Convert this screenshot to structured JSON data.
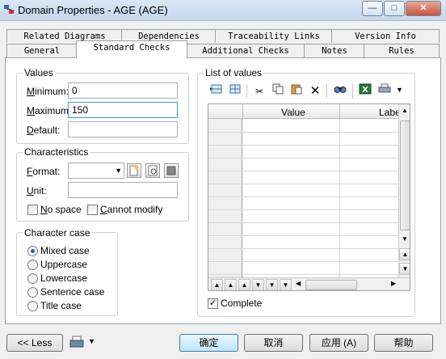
{
  "window": {
    "title": "Domain Properties - AGE (AGE)"
  },
  "tabs_row1": [
    "Related Diagrams",
    "Dependencies",
    "Traceability Links",
    "Version Info"
  ],
  "tabs_row2": [
    "General",
    "Standard Checks",
    "Additional Checks",
    "Notes",
    "Rules"
  ],
  "active_tab": "Standard Checks",
  "values_group": {
    "title": "Values",
    "minimum_label_u": "M",
    "minimum_label_rest": "inimum:",
    "minimum_value": "0",
    "maximum_label_u": "M",
    "maximum_label_rest": "aximum:",
    "maximum_value": "150",
    "default_label_u": "D",
    "default_label_rest": "efault:",
    "default_value": ""
  },
  "characteristics_group": {
    "title": "Characteristics",
    "format_label_u": "F",
    "format_label_rest": "ormat:",
    "format_value": "",
    "unit_label_u": "U",
    "unit_label_rest": "nit:",
    "unit_value": "",
    "no_space_u": "N",
    "no_space_rest": "o space",
    "no_space_checked": false,
    "cannot_modify_u": "C",
    "cannot_modify_rest": "annot modify",
    "cannot_modify_checked": false
  },
  "character_case_group": {
    "title": "Character case",
    "options": [
      "Mixed case",
      "Uppercase",
      "Lowercase",
      "Sentence case",
      "Title case"
    ],
    "selected": "Mixed case"
  },
  "list_of_values": {
    "title": "List of values",
    "columns": [
      "Value",
      "Labe"
    ],
    "rows": []
  },
  "complete_checkbox": {
    "label": "Complete",
    "checked": true
  },
  "buttons": {
    "less": "<< Less",
    "ok": "确定",
    "cancel": "取消",
    "apply": "应用 (A)",
    "help": "帮助"
  },
  "icons": [
    "insert-row-icon",
    "add-row-icon",
    "cut-icon",
    "copy-icon",
    "paste-icon",
    "delete-icon",
    "find-icon",
    "excel-icon",
    "print-icon"
  ]
}
